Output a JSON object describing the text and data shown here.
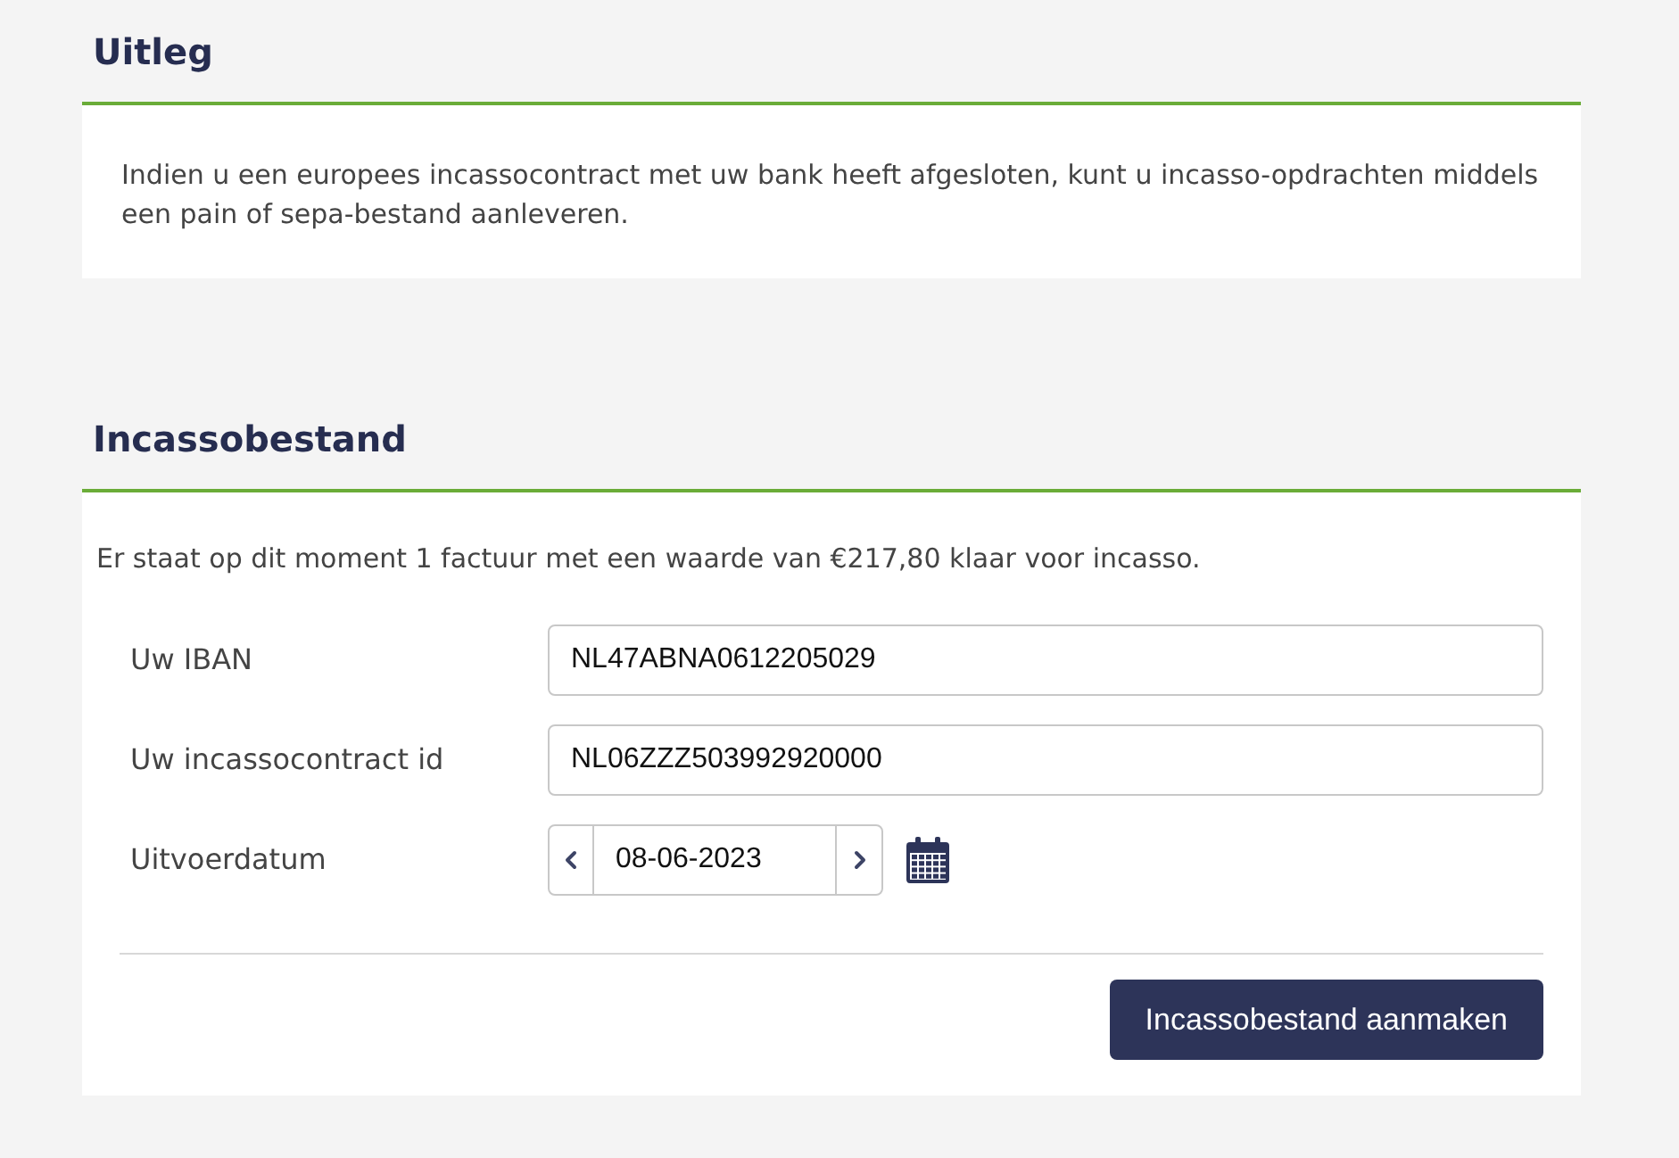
{
  "explanation": {
    "title": "Uitleg",
    "text": "Indien u een europees incassocontract met uw bank heeft afgesloten, kunt u incasso-opdrachten middels een pain of sepa-bestand aanleveren."
  },
  "file": {
    "title": "Incassobestand",
    "summary": "Er staat op dit moment 1 factuur met een waarde van €217,80 klaar voor incasso.",
    "fields": [
      {
        "kind": "text",
        "label": "Uw IBAN",
        "value": "NL47ABNA0612205029"
      },
      {
        "kind": "text",
        "label": "Uw incassocontract id",
        "value": "NL06ZZZ503992920000"
      },
      {
        "kind": "date",
        "label": "Uitvoerdatum",
        "value": "08-06-2023"
      }
    ],
    "button": "Incassobestand aanmaken"
  }
}
